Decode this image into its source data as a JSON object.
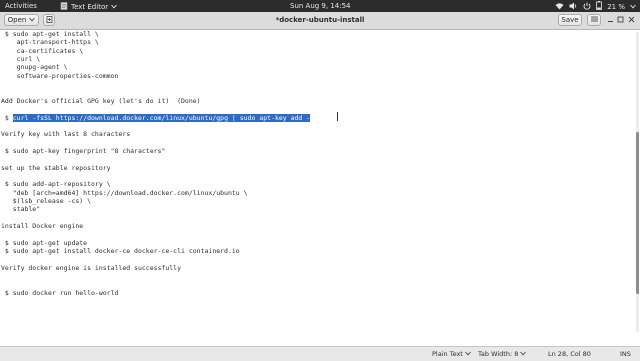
{
  "topbar": {
    "activities": "Activities",
    "app_name": "Text Editor",
    "clock": "Sun Aug  9, 14:54",
    "battery": "21 %"
  },
  "headerbar": {
    "open_label": "Open",
    "title": "*docker-ubuntu-install",
    "save_label": "Save"
  },
  "editor": {
    "lines": [
      {
        "text": " $ sudo apt-get install \\"
      },
      {
        "text": "    apt-transport-https \\"
      },
      {
        "text": "    ca-certificates \\"
      },
      {
        "text": "    curl \\"
      },
      {
        "text": "    gnupg-agent \\"
      },
      {
        "text": "    software-properties-common"
      },
      {
        "text": ""
      },
      {
        "text": ""
      },
      {
        "text": "Add Docker's official GPG key (let's do it)  (Done)"
      },
      {
        "text": ""
      },
      {
        "text": " $ ",
        "selected": "curl -fsSL https://download.docker.com/linux/ubuntu/gpg | sudo apt-key add -"
      },
      {
        "text": ""
      },
      {
        "text": "Verify key with last 8 characters"
      },
      {
        "text": ""
      },
      {
        "text": " $ sudo apt-key fingerprint \"8 characters\""
      },
      {
        "text": ""
      },
      {
        "text": "set up the stable repository"
      },
      {
        "text": ""
      },
      {
        "text": " $ sudo add-apt-repository \\"
      },
      {
        "text": "   \"deb [arch=amd64] https://download.docker.com/linux/ubuntu \\"
      },
      {
        "text": "   $(lsb_release -cs) \\"
      },
      {
        "text": "   stable\""
      },
      {
        "text": ""
      },
      {
        "text": "install Docker engine"
      },
      {
        "text": ""
      },
      {
        "text": " $ sudo apt-get update"
      },
      {
        "text": " $ sudo apt-get install docker-ce docker-ce-cli containerd.io"
      },
      {
        "text": ""
      },
      {
        "text": "Verify docker engine is installed successfully"
      },
      {
        "text": ""
      },
      {
        "text": ""
      },
      {
        "text": " $ sudo docker run hello-world"
      }
    ]
  },
  "statusbar": {
    "language": "Plain Text",
    "tab_width": "Tab Width: 8",
    "position": "Ln 28, Col 80",
    "mode": "INS"
  },
  "icons": {
    "network": "network-icon",
    "volume": "volume-icon",
    "power": "power-icon",
    "battery": "battery-icon"
  }
}
